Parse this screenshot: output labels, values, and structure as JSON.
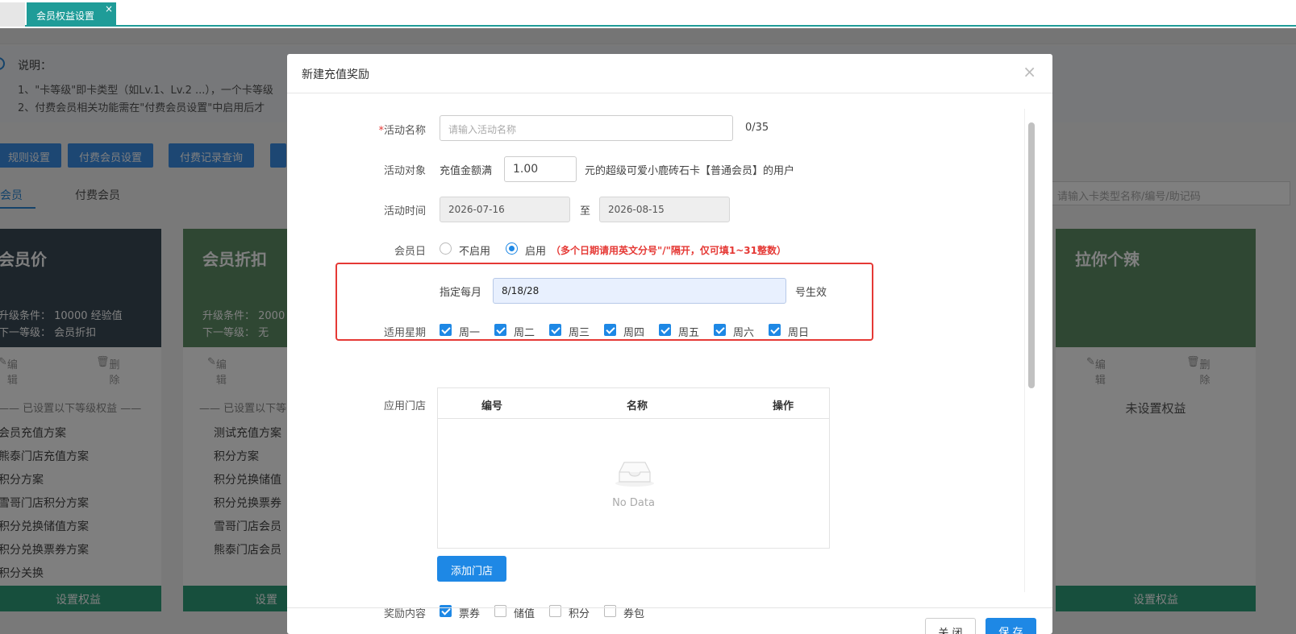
{
  "tabs": {
    "active_label": "会员权益设置",
    "close_glyph": "×"
  },
  "background": {
    "notice_title": "说明：",
    "notice_lines": [
      "1、\"卡等级\"即卡类型（如Lv.1、Lv.2 ...），一个卡等级",
      "2、付费会员相关功能需在\"付费会员设置\"中启用后才"
    ],
    "buttons": [
      "规则设置",
      "付费会员设置",
      "付费记录查询"
    ],
    "subtabs": [
      "会员",
      "付费会员"
    ],
    "search_placeholder": "请输入卡类型名称/编号/助记码",
    "cards": [
      {
        "title": "会员价",
        "lines": [
          "升级条件：  10000 经验值",
          "下一等级：  会员折扣"
        ],
        "edit": "编辑",
        "delete": "删除",
        "sep": "—— 已设置以下等级权益 ——",
        "items": [
          "会员充值方案",
          "熊泰门店充值方案",
          "积分方案",
          "雪哥门店积分方案",
          "积分兑换储值方案",
          "积分兑换票券方案",
          "积分关换"
        ],
        "foot": "设置权益"
      },
      {
        "title": "会员折扣",
        "lines": [
          "升级条件：  2000",
          "下一等级：  无"
        ],
        "edit": "编辑",
        "delete": "删除",
        "sep": "—— 已设置以下等",
        "items": [
          "测试充值方案",
          "积分方案",
          "积分兑换储值",
          "积分兑换票券",
          "雪哥门店会员",
          "熊泰门店会员"
        ],
        "foot": "设置"
      },
      {
        "title": "拉你个辣",
        "edit": "编辑",
        "delete": "删除",
        "empty": "未设置权益",
        "foot": "设置权益"
      }
    ]
  },
  "dialog": {
    "title": "新建充值奖励",
    "close_glyph": "×",
    "form": {
      "name_label": "活动名称",
      "name_required": "*",
      "name_placeholder": "请输入活动名称",
      "name_counter": "0/35",
      "target_label": "活动对象",
      "target_prefix": "充值金额满",
      "target_amount": "1.00",
      "target_suffix": "元的超级可爱小鹿砖石卡【普通会员】的用户",
      "time_label": "活动时间",
      "time_start": "2026-07-16",
      "time_sep": "至",
      "time_end": "2026-08-15",
      "memberday_label": "会员日",
      "memberday_off": "不启用",
      "memberday_on": "启用",
      "memberday_tip": "（多个日期请用英文分号\"/\"隔开，仅可填1~31整数）",
      "monthly_label": "指定每月",
      "monthly_value": "8/18/28",
      "monthly_suffix": "号生效",
      "week_label": "适用星期",
      "weekdays": [
        "周一",
        "周二",
        "周三",
        "周四",
        "周五",
        "周六",
        "周日"
      ],
      "store_label": "应用门店",
      "store_columns": [
        "编号",
        "名称",
        "操作"
      ],
      "store_empty": "No Data",
      "add_store": "添加门店",
      "reward_label": "奖励内容",
      "rewards": [
        {
          "label": "票券",
          "checked": true
        },
        {
          "label": "储值",
          "checked": false
        },
        {
          "label": "积分",
          "checked": false
        },
        {
          "label": "券包",
          "checked": false
        }
      ]
    },
    "footer": {
      "close": "关 闭",
      "save": "保 存"
    }
  },
  "colors": {
    "accent": "#1e88e5",
    "tab": "#1f9c98",
    "highlight": "#e53935"
  }
}
